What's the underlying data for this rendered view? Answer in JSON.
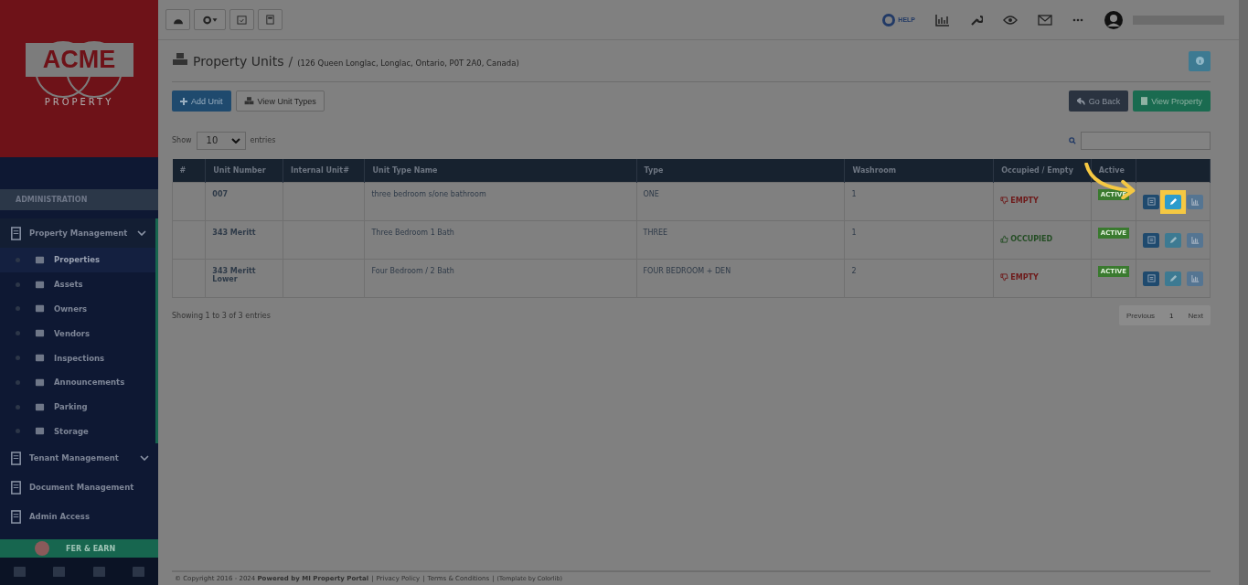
{
  "logo": {
    "name": "ACME",
    "tagline": "PROPERTY"
  },
  "toolbar": {
    "help": "HELP"
  },
  "sidebar": {
    "section": "ADMINISTRATION",
    "groups": [
      {
        "label": "Property Management",
        "expanded": true,
        "children": [
          {
            "label": "Properties",
            "selected": true
          },
          {
            "label": "Assets",
            "selected": false
          },
          {
            "label": "Owners",
            "selected": false
          },
          {
            "label": "Vendors",
            "selected": false
          },
          {
            "label": "Inspections",
            "selected": false
          },
          {
            "label": "Announcements",
            "selected": false
          },
          {
            "label": "Parking",
            "selected": false
          },
          {
            "label": "Storage",
            "selected": false
          }
        ]
      },
      {
        "label": "Tenant Management",
        "expanded": false
      },
      {
        "label": "Document Management"
      },
      {
        "label": "Admin Access"
      }
    ],
    "promo": "FER & EARN"
  },
  "page": {
    "title": "Property Units",
    "separator": "/",
    "subtitle": "(126 Queen Longlac, Longlac, Ontario, P0T 2A0, Canada)",
    "buttons": [
      "Add Unit",
      "View Unit Types",
      "Go Back",
      "View Property"
    ]
  },
  "table": {
    "show": "Show",
    "page_size": "10",
    "entries": "entries",
    "columns": [
      "#",
      "Unit Number",
      "Internal Unit#",
      "Unit Type Name",
      "Type",
      "Washroom",
      "Occupied / Empty",
      "Active"
    ],
    "rows": [
      {
        "unit_number": "007",
        "unit_type_name": "three bedroom s/one bathroom",
        "type": "ONE",
        "washroom": "1",
        "status": {
          "kind": "empty",
          "label": "EMPTY"
        },
        "active": "ACTIVE",
        "highlighted": true
      },
      {
        "unit_number": "343 Meritt",
        "unit_type_name": "Three Bedroom 1 Bath",
        "type": "THREE",
        "washroom": "1",
        "status": {
          "kind": "occupied",
          "label": "OCCUPIED"
        },
        "active": "ACTIVE",
        "highlighted": false
      },
      {
        "unit_number": "343 Meritt Lower",
        "unit_type_name": "Four Bedroom / 2 Bath",
        "type": "FOUR BEDROOM + DEN",
        "washroom": "2",
        "status": {
          "kind": "empty",
          "label": "EMPTY"
        },
        "active": "ACTIVE",
        "highlighted": false
      }
    ],
    "info": "Showing 1 to 3 of 3 entries",
    "pagination": {
      "previous": "Previous",
      "page": "1",
      "next": "Next"
    }
  },
  "footer": {
    "copyright": "© Copyright 2016 - 2024 **Powered by MI Property Portal**",
    "separator": "|",
    "links": [
      "Privacy Policy",
      "Terms & Conditions"
    ],
    "credit": "(Template by Colorlib)"
  }
}
